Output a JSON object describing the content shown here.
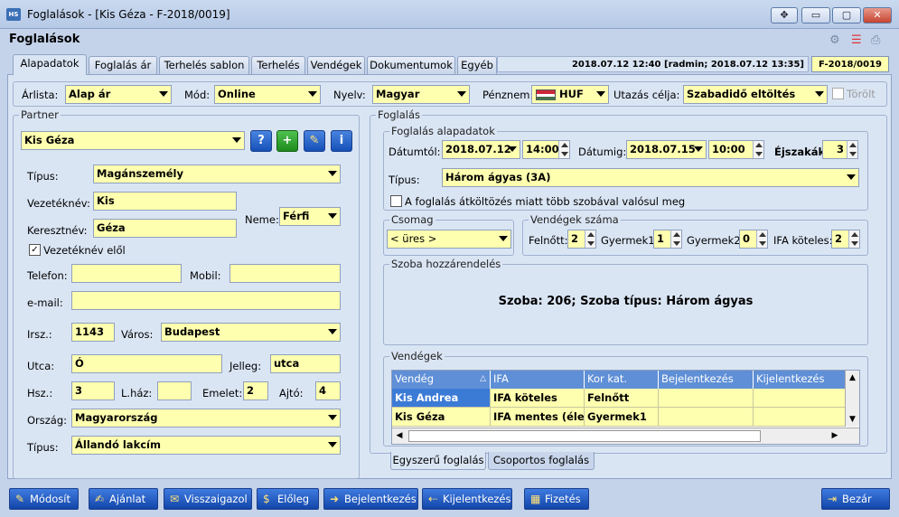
{
  "window": {
    "title": "Foglalások - [Kis Géza - F-2018/0019]",
    "app_icon": "HS",
    "min": "▭",
    "max": "▢",
    "close": "✕",
    "move": "✥"
  },
  "form_title": "Foglalások",
  "tabs": [
    "Alapadatok",
    "Foglalás ár",
    "Terhelés sablon",
    "Terhelés",
    "Vendégek",
    "Dokumentumok",
    "Egyéb"
  ],
  "datetime_info": "2018.07.12 12:40 [radmin; 2018.07.12 13:35]",
  "booking_code": "F-2018/0019",
  "top": {
    "arlista_label": "Árlista:",
    "arlista": "Alap ár",
    "mod_label": "Mód:",
    "mod": "Online",
    "nyelv_label": "Nyelv:",
    "nyelv": "Magyar",
    "penznem_label": "Pénznem:",
    "penznem": "HUF",
    "utazas_label": "Utazás célja:",
    "utazas": "Szabadidő eltöltés",
    "torolt": "Törölt"
  },
  "partner": {
    "title": "Partner",
    "name": "Kis Géza",
    "tipus_label": "Típus:",
    "tipus": "Magánszemély",
    "vezeteknev_label": "Vezetéknév:",
    "vezeteknev": "Kis",
    "keresztnev_label": "Keresztnév:",
    "keresztnev": "Géza",
    "neme_label": "Neme:",
    "neme": "Férfi",
    "vezeteknev_elol": "Vezetéknév elől",
    "telefon_label": "Telefon:",
    "telefon": "",
    "mobil_label": "Mobil:",
    "mobil": "",
    "email_label": "e-mail:",
    "email": "",
    "irsz_label": "Irsz.:",
    "irsz": "1143",
    "varos_label": "Város:",
    "varos": "Budapest",
    "utca_label": "Utca:",
    "utca": "Ó",
    "jelleg_label": "Jelleg:",
    "jelleg": "utca",
    "hsz_label": "Hsz.:",
    "hsz": "3",
    "lhaz_label": "L.ház:",
    "lhaz": "",
    "emelet_label": "Emelet:",
    "emelet": "2",
    "ajto_label": "Ajtó:",
    "ajto": "4",
    "orszag_label": "Ország:",
    "orszag": "Magyarország",
    "tipus2_label": "Típus:",
    "tipus2": "Állandó lakcím"
  },
  "foglalas": {
    "title": "Foglalás",
    "alap_title": "Foglalás alapadatok",
    "datumtol_label": "Dátumtól:",
    "datumtol": "2018.07.12",
    "ido1": "14:00",
    "datumig_label": "Dátumig:",
    "datumig": "2018.07.15",
    "ido2": "10:00",
    "ejszakak_label": "Éjszakák:",
    "ejszakak": "3",
    "tipus_label": "Típus:",
    "tipus": "Három ágyas (3A)",
    "atkoltozes": "A foglalás átköltözés miatt több szobával valósul meg",
    "csomag_title": "Csomag",
    "csomag": "< üres >",
    "vendegek_szama_title": "Vendégek száma",
    "felnott_label": "Felnőtt:",
    "felnott": "2",
    "gyermek1_label": "Gyermek1:",
    "gyermek1": "1",
    "gyermek2_label": "Gyermek2:",
    "gyermek2": "0",
    "ifa_label": "IFA köteles:",
    "ifa": "2",
    "szoba_title": "Szoba hozzárendelés",
    "szoba_text": "Szoba: 206; Szoba típus: Három ágyas",
    "vendegek_title": "Vendégek"
  },
  "grid": {
    "headers": [
      "Vendég",
      "IFA",
      "Kor kat.",
      "Bejelentkezés",
      "Kijelentkezés"
    ],
    "rows": [
      [
        "Kis Andrea",
        "IFA köteles",
        "Felnőtt",
        "",
        ""
      ],
      [
        "Kis Géza",
        "IFA mentes (életkor)",
        "Gyermek1",
        "",
        ""
      ]
    ]
  },
  "subtabs": [
    "Egyszerű foglalás",
    "Csoportos foglalás"
  ],
  "buttons": {
    "modosit": "Módosít",
    "ajanlat": "Ajánlat",
    "visszaigazol": "Visszaigazol",
    "eloleg": "Előleg",
    "bejelentkezes": "Bejelentkezés",
    "kijelentkezes": "Kijelentkezés",
    "fizetes": "Fizetés",
    "bezar": "Bezár"
  }
}
